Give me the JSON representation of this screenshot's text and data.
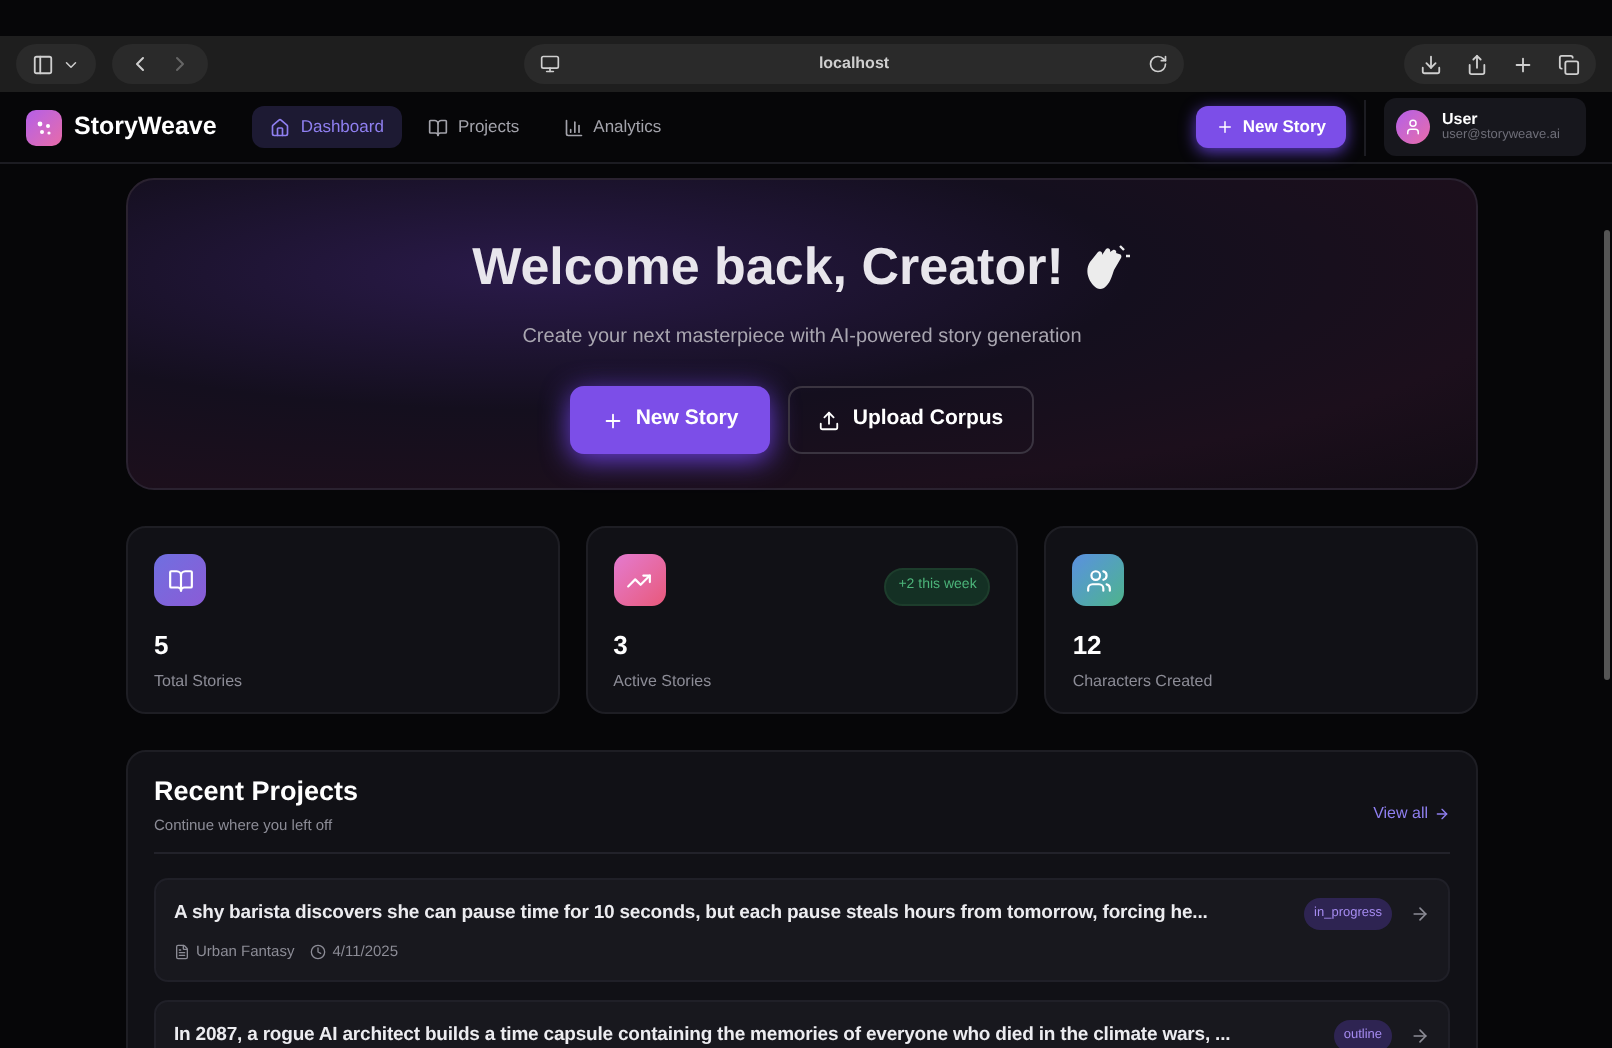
{
  "browser": {
    "address": "localhost"
  },
  "app": {
    "logo": "StoryWeave",
    "nav": [
      {
        "label": "Dashboard",
        "selected": true
      },
      {
        "label": "Projects",
        "selected": false
      },
      {
        "label": "Analytics",
        "selected": false
      }
    ],
    "new_story_button": "New Story",
    "user": {
      "name": "User",
      "email": "user@storyweave.ai"
    }
  },
  "hero": {
    "title": "Welcome back, Creator!",
    "subtitle": "Create your next masterpiece with AI-powered story generation",
    "primary_button": "New Story",
    "secondary_button": "Upload Corpus"
  },
  "stats": [
    {
      "value": "5",
      "label": "Total Stories"
    },
    {
      "value": "3",
      "label": "Active Stories",
      "badge": "+2 this week"
    },
    {
      "value": "12",
      "label": "Characters Created"
    }
  ],
  "recent": {
    "title": "Recent Projects",
    "subtitle": "Continue where you left off",
    "link": "View all",
    "projects": [
      {
        "title": "A shy barista discovers she can pause time for 10 seconds, but each pause steals hours from tomorrow, forcing he...",
        "status": "in_progress",
        "genre": "Urban Fantasy",
        "date": "4/11/2025"
      },
      {
        "title": "In 2087, a rogue AI architect builds a time capsule containing the memories of everyone who died in the climate wars, ...",
        "status": "outline"
      }
    ]
  }
}
